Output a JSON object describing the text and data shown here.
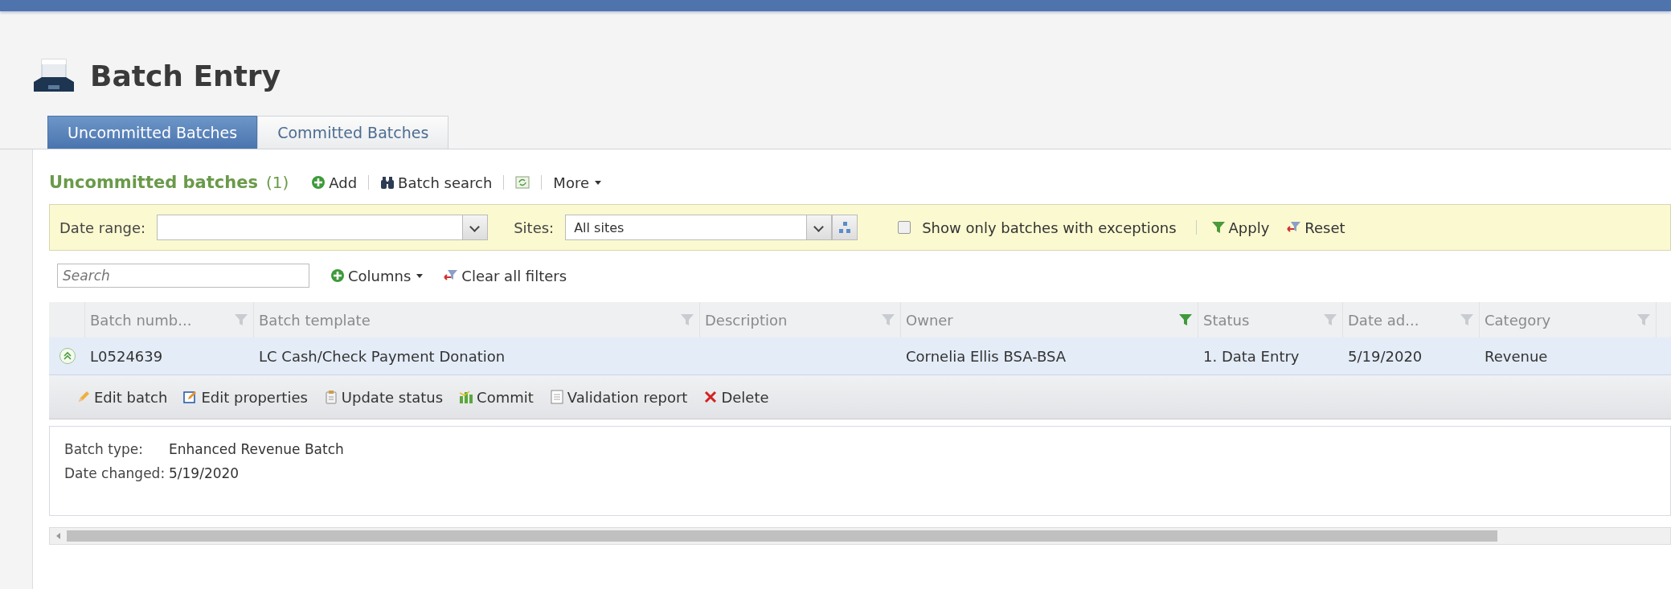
{
  "page": {
    "title": "Batch Entry"
  },
  "tabs": [
    {
      "label": "Uncommitted Batches",
      "selected": true
    },
    {
      "label": "Committed Batches",
      "selected": false
    }
  ],
  "section": {
    "title": "Uncommitted batches",
    "count": "(1)",
    "actions": [
      {
        "kind": "add",
        "label": "Add"
      },
      {
        "kind": "search",
        "label": "Batch search"
      },
      {
        "kind": "refresh"
      },
      {
        "kind": "more",
        "label": "More"
      }
    ]
  },
  "filters": {
    "date_range": {
      "label": "Date range:"
    },
    "sites": {
      "label": "Sites:",
      "value": "All sites"
    },
    "exceptions": {
      "label": "Show only batches with exceptions",
      "checked": false
    },
    "apply": "Apply",
    "reset": "Reset"
  },
  "grid_toolbar": {
    "search": {
      "placeholder": "Search"
    },
    "columns": "Columns",
    "clear_filters": "Clear all filters"
  },
  "table": {
    "columns": [
      {
        "label": "Batch numb...",
        "filtered": false
      },
      {
        "label": "Batch template",
        "filtered": false
      },
      {
        "label": "Description",
        "filtered": false
      },
      {
        "label": "Owner",
        "filtered": true
      },
      {
        "label": "Status",
        "filtered": false
      },
      {
        "label": "Date ad...",
        "filtered": false
      },
      {
        "label": "Category",
        "filtered": false
      }
    ],
    "rows": [
      {
        "expanded": true,
        "selected": true,
        "cells": [
          "L0524639",
          "LC Cash/Check Payment Donation",
          "",
          "Cornelia Ellis BSA-BSA",
          "1. Data Entry",
          "5/19/2020",
          "Revenue"
        ],
        "actions": [
          {
            "kind": "edit",
            "label": "Edit batch"
          },
          {
            "kind": "properties",
            "label": "Edit properties"
          },
          {
            "kind": "status",
            "label": "Update status"
          },
          {
            "kind": "commit",
            "label": "Commit"
          },
          {
            "kind": "report",
            "label": "Validation report"
          },
          {
            "kind": "delete",
            "label": "Delete"
          }
        ],
        "details": [
          {
            "label": "Batch type:",
            "value": "Enhanced Revenue Batch"
          },
          {
            "label": "Date changed:",
            "value": "5/19/2020"
          }
        ]
      }
    ]
  }
}
